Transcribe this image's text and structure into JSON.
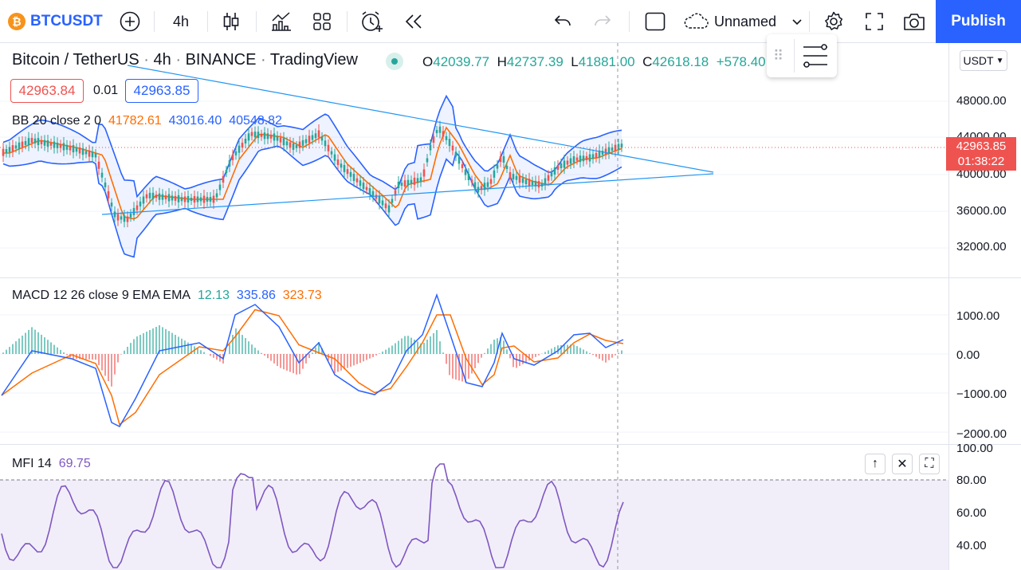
{
  "toolbar": {
    "symbol": "BTCUSDT",
    "symbol_logo": "₿",
    "interval": "4h",
    "layout_name": "Unnamed",
    "publish_label": "Publish"
  },
  "legend": {
    "title_parts": [
      "Bitcoin / TetherUS",
      "4h",
      "BINANCE",
      "TradingView"
    ],
    "separator": "·",
    "ohlc": [
      {
        "k": "O",
        "v": "42039.77"
      },
      {
        "k": "H",
        "v": "42737.39"
      },
      {
        "k": "L",
        "v": "41881.00"
      },
      {
        "k": "C",
        "v": "42618.18"
      }
    ],
    "change": "+578.40",
    "bid": "42963.84",
    "spread": "0.01",
    "ask": "42963.85"
  },
  "indicators": {
    "bb": {
      "label": "BB 20 close 2 0",
      "basis": "41782.61",
      "upper": "43016.40",
      "lower": "40548.82"
    },
    "macd": {
      "label": "MACD 12 26 close 9 EMA EMA",
      "hist": "12.13",
      "macd": "335.86",
      "signal": "323.73"
    },
    "mfi": {
      "label": "MFI 14",
      "value": "69.75"
    }
  },
  "price_scale": {
    "currency": "USDT",
    "main_ticks": [
      "48000.00",
      "44000.00",
      "40000.00",
      "36000.00",
      "32000.00"
    ],
    "macd_ticks": [
      "1000.00",
      "0.00",
      "−1000.00",
      "−2000.00"
    ],
    "mfi_ticks": [
      "100.00",
      "80.00",
      "60.00",
      "40.00"
    ],
    "last_price": "42963.85",
    "countdown": "01:38:22"
  },
  "colors": {
    "accent": "#2962ff",
    "up": "#26a69a",
    "down": "#ef5350",
    "bb_line": "#2962ff",
    "basis": "#ff6d00",
    "mfi": "#7e57c2"
  }
}
